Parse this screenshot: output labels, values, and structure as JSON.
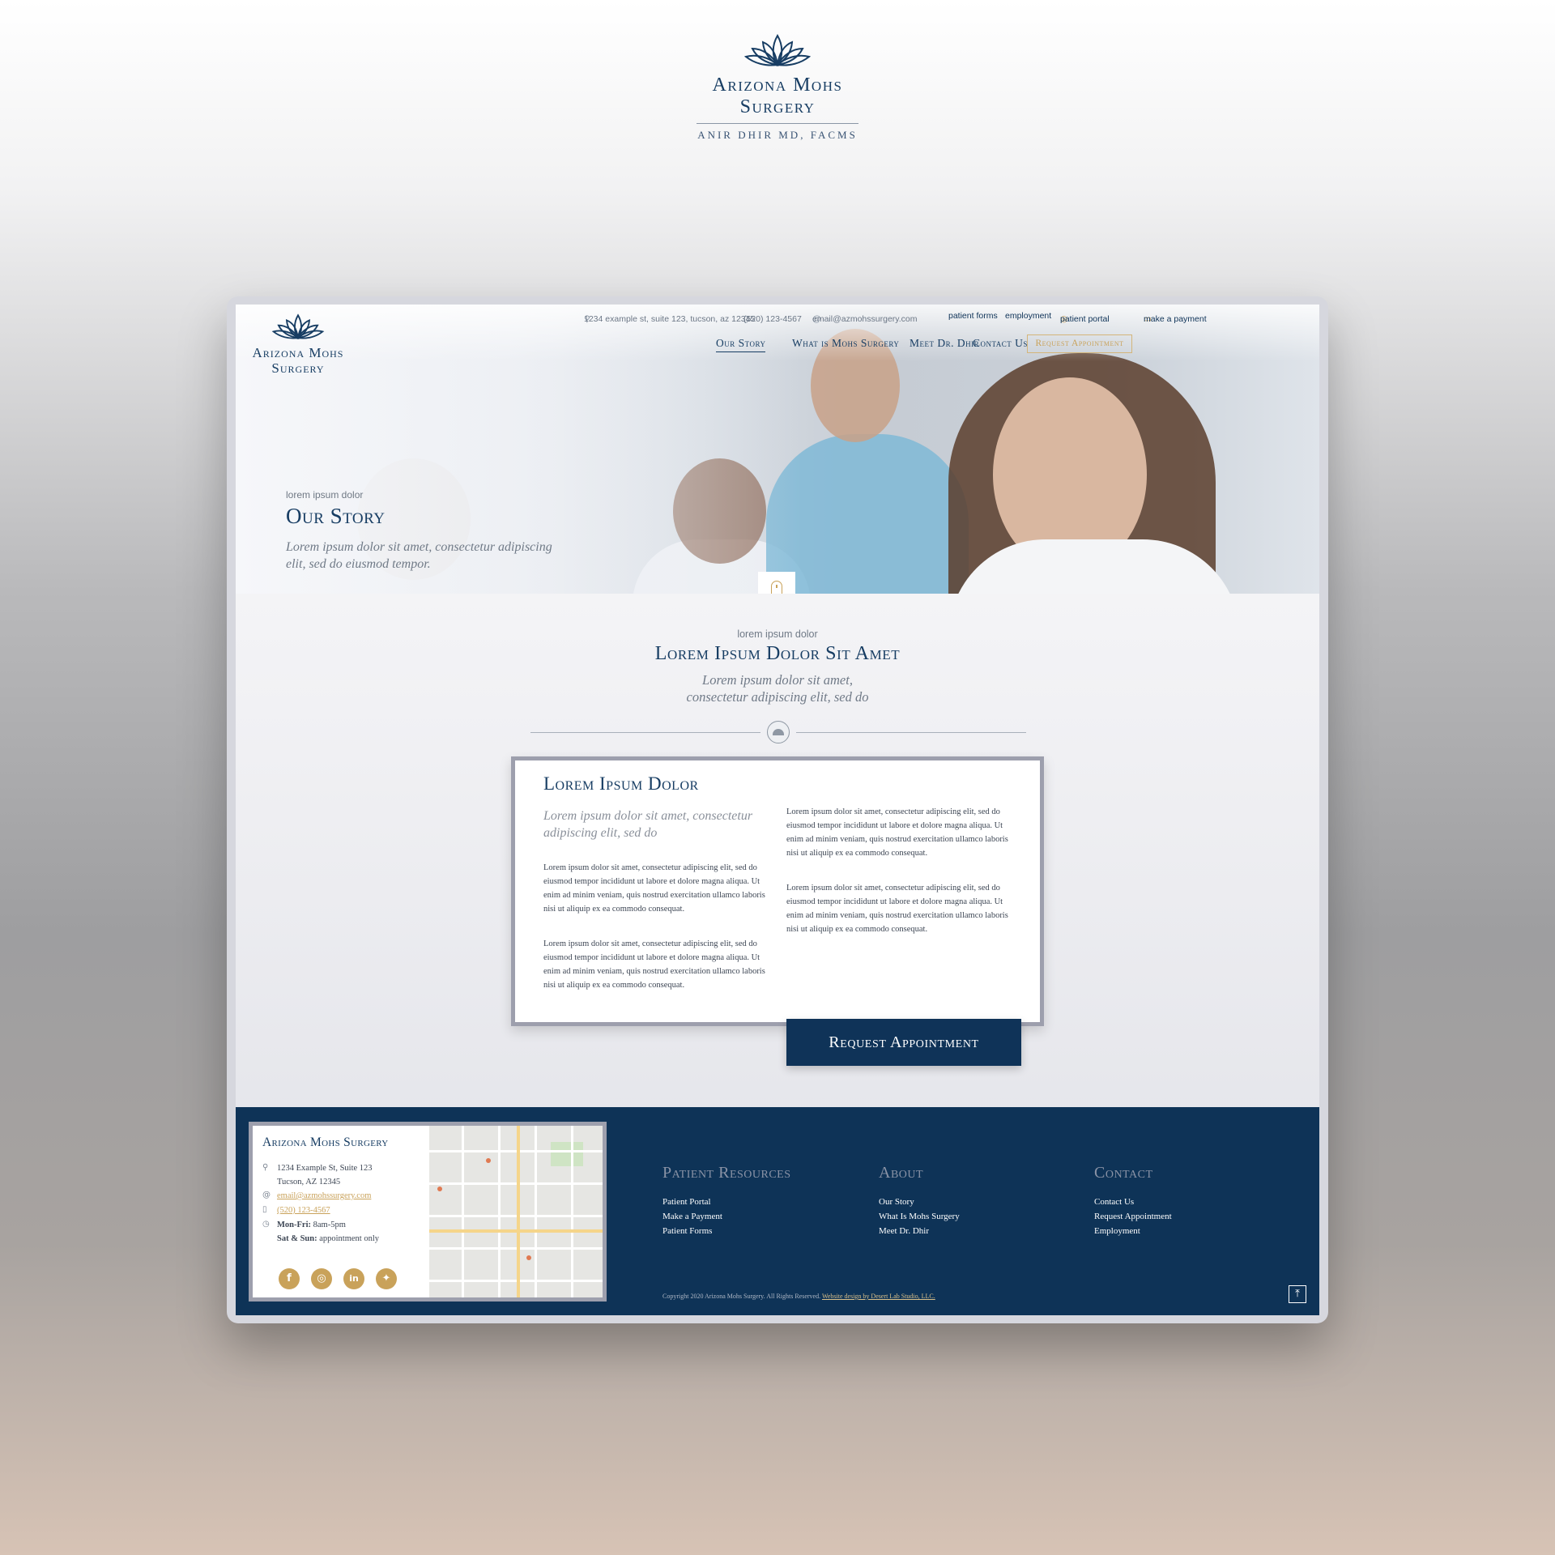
{
  "brand": {
    "name_line1": "Arizona Mohs",
    "name_line2": "Surgery",
    "subtitle": "ANIR DHIR MD, FACMS"
  },
  "utility_bar": {
    "address": "1234 example st, suite 123, tucson, az 12345",
    "phone": "(520) 123-4567",
    "email": "email@azmohssurgery.com",
    "links": [
      "patient forms",
      "employment",
      "patient portal",
      "make a payment"
    ]
  },
  "nav": {
    "items": [
      "Our Story",
      "What is Mohs Surgery",
      "Meet Dr. Dhir",
      "Contact Us"
    ],
    "active": "Our Story",
    "cta": "Request Appointment"
  },
  "hero": {
    "kicker": "lorem ipsum dolor",
    "title": "Our Story",
    "text": "Lorem ipsum dolor sit amet, consectetur adipiscing elit, sed do eiusmod tempor."
  },
  "intro": {
    "kicker": "lorem ipsum dolor",
    "title": "Lorem Ipsum Dolor Sit Amet",
    "line1": "Lorem ipsum dolor sit amet,",
    "line2": "consectetur adipiscing elit, sed do"
  },
  "card": {
    "title": "Lorem Ipsum Dolor",
    "lead": "Lorem ipsum dolor sit amet, consectetur adipiscing elit, sed do",
    "paragraph": "Lorem ipsum dolor sit amet, consectetur adipiscing elit, sed do eiusmod tempor incididunt ut labore et dolore magna aliqua. Ut enim ad minim veniam, quis nostrud exercitation ullamco laboris nisi ut aliquip ex ea commodo consequat."
  },
  "cta": {
    "label": "Request Appointment"
  },
  "footer": {
    "contact_card": {
      "title": "Arizona Mohs Surgery",
      "address_line1": "1234 Example St, Suite 123",
      "address_line2": "Tucson, AZ 12345",
      "email": "email@azmohssurgery.com",
      "phone": "(520) 123-4567",
      "hours_label_1": "Mon-Fri:",
      "hours_value_1": "8am-5pm",
      "hours_label_2": "Sat & Sun:",
      "hours_value_2": "appointment only",
      "socials": [
        "facebook-icon",
        "instagram-icon",
        "linkedin-icon",
        "twitter-icon"
      ]
    },
    "columns": [
      {
        "heading": "Patient Resources",
        "links": [
          "Patient Portal",
          "Make a Payment",
          "Patient Forms"
        ]
      },
      {
        "heading": "About",
        "links": [
          "Our Story",
          "What Is Mohs Surgery",
          "Meet Dr. Dhir"
        ]
      },
      {
        "heading": "Contact",
        "links": [
          "Contact Us",
          "Request Appointment",
          "Employment"
        ]
      }
    ],
    "copyright": "Copyright 2020 Arizona Mohs Surgery. All Rights Reserved.",
    "credit": "Website design by Desert Lab Studio, LLC."
  },
  "colors": {
    "navy": "#0f3358",
    "gold": "#c9a25a",
    "gray_text": "#707a87"
  }
}
